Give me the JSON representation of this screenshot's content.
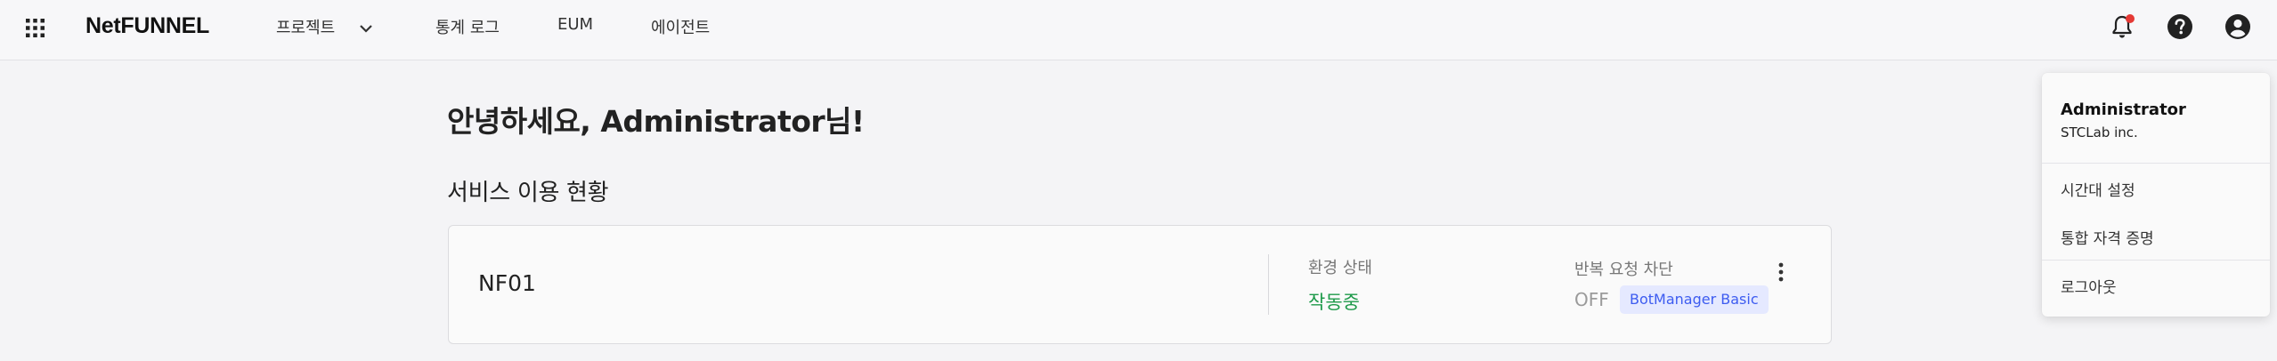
{
  "header": {
    "logo": "NetFUNNEL",
    "nav": {
      "project": "프로젝트",
      "stats_log": "통계 로그",
      "eum": "EUM",
      "agent": "에이전트"
    },
    "icons": [
      "apps-grid-icon",
      "chevron-down-icon",
      "bell-icon",
      "help-icon",
      "account-icon"
    ],
    "notification_dot_color": "#e53935"
  },
  "main": {
    "greeting": "안녕하세요, Administrator님!",
    "section_title": "서비스 이용 현황",
    "service": {
      "name": "NF01",
      "env_status_label": "환경 상태",
      "env_status_value": "작동중",
      "env_status_color": "#1e9a4a",
      "repeat_block_label": "반복 요청 차단",
      "repeat_block_value": "OFF",
      "badge": "BotManager Basic",
      "menu_icon": "more-vert-icon"
    }
  },
  "user_menu": {
    "name": "Administrator",
    "company": "STCLab inc.",
    "items": {
      "timezone": "시간대 설정",
      "credentials": "통합 자격 증명",
      "logout": "로그아웃"
    }
  }
}
